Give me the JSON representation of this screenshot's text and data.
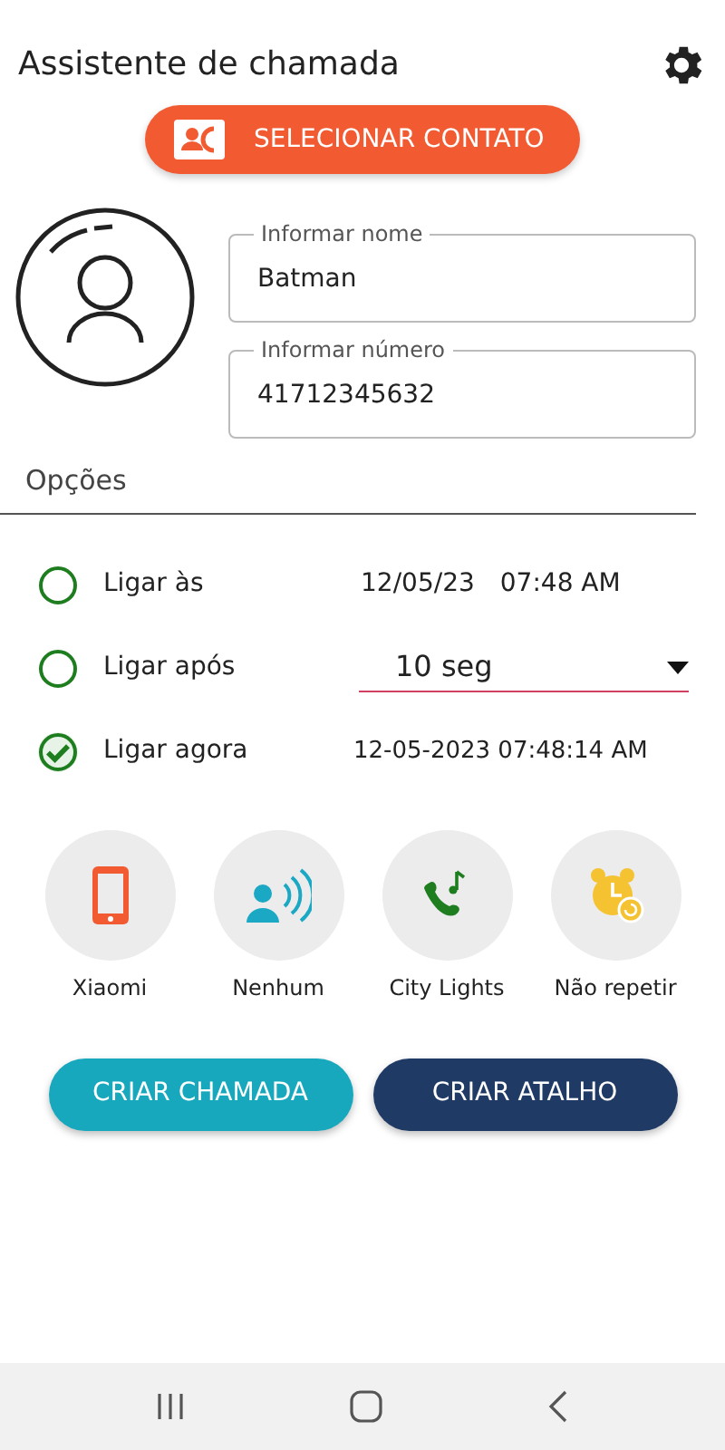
{
  "header": {
    "title": "Assistente de chamada"
  },
  "select_contact_button": {
    "label": "SELECIONAR CONTATO"
  },
  "fields": [
    {
      "label": "Informar nome",
      "value": "Batman"
    },
    {
      "label": "Informar número",
      "value": "41712345632"
    }
  ],
  "options": {
    "title": "Opções",
    "items": [
      {
        "label": "Ligar às",
        "selected": false,
        "kind": "datetime",
        "date": "12/05/23",
        "time": "07:48 AM"
      },
      {
        "label": "Ligar após",
        "selected": false,
        "kind": "select",
        "value": "10 seg"
      },
      {
        "label": "Ligar agora",
        "selected": true,
        "kind": "text",
        "value": "12-05-2023 07:48:14 AM"
      }
    ]
  },
  "shortcuts": [
    {
      "kind": "phone",
      "label": "Xiaomi"
    },
    {
      "kind": "speaker",
      "label": "Nenhum"
    },
    {
      "kind": "ringtone",
      "label": "City Lights"
    },
    {
      "kind": "alarm",
      "label": "Não repetir"
    }
  ],
  "actions": [
    {
      "kind": "primary",
      "label": "CRIAR CHAMADA"
    },
    {
      "kind": "secondary",
      "label": "CRIAR ATALHO"
    }
  ]
}
